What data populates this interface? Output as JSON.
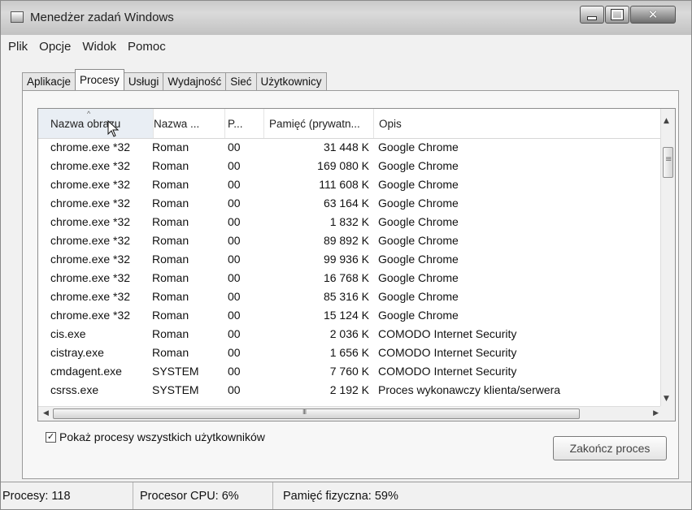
{
  "window": {
    "title": "Menedżer zadań Windows",
    "controls": [
      "minimize",
      "maximize",
      "close"
    ]
  },
  "menu": [
    "Plik",
    "Opcje",
    "Widok",
    "Pomoc"
  ],
  "tabs": {
    "items": [
      "Aplikacje",
      "Procesy",
      "Usługi",
      "Wydajność",
      "Sieć",
      "Użytkownicy"
    ],
    "active": "Procesy"
  },
  "table": {
    "columns": [
      "Nazwa obrazu",
      "Nazwa ...",
      "P...",
      "Pamięć (prywatn...",
      "Opis"
    ],
    "sorted_column": "Nazwa obrazu",
    "rows": [
      {
        "name": "chrome.exe *32",
        "user": "Roman",
        "cpu": "00",
        "memory": "31 448 K",
        "description": "Google Chrome"
      },
      {
        "name": "chrome.exe *32",
        "user": "Roman",
        "cpu": "00",
        "memory": "169 080 K",
        "description": "Google Chrome"
      },
      {
        "name": "chrome.exe *32",
        "user": "Roman",
        "cpu": "00",
        "memory": "111 608 K",
        "description": "Google Chrome"
      },
      {
        "name": "chrome.exe *32",
        "user": "Roman",
        "cpu": "00",
        "memory": "63 164 K",
        "description": "Google Chrome"
      },
      {
        "name": "chrome.exe *32",
        "user": "Roman",
        "cpu": "00",
        "memory": "1 832 K",
        "description": "Google Chrome"
      },
      {
        "name": "chrome.exe *32",
        "user": "Roman",
        "cpu": "00",
        "memory": "89 892 K",
        "description": "Google Chrome"
      },
      {
        "name": "chrome.exe *32",
        "user": "Roman",
        "cpu": "00",
        "memory": "99 936 K",
        "description": "Google Chrome"
      },
      {
        "name": "chrome.exe *32",
        "user": "Roman",
        "cpu": "00",
        "memory": "16 768 K",
        "description": "Google Chrome"
      },
      {
        "name": "chrome.exe *32",
        "user": "Roman",
        "cpu": "00",
        "memory": "85 316 K",
        "description": "Google Chrome"
      },
      {
        "name": "chrome.exe *32",
        "user": "Roman",
        "cpu": "00",
        "memory": "15 124 K",
        "description": "Google Chrome"
      },
      {
        "name": "cis.exe",
        "user": "Roman",
        "cpu": "00",
        "memory": "2 036 K",
        "description": "COMODO Internet Security"
      },
      {
        "name": "cistray.exe",
        "user": "Roman",
        "cpu": "00",
        "memory": "1 656 K",
        "description": "COMODO Internet Security"
      },
      {
        "name": "cmdagent.exe",
        "user": "SYSTEM",
        "cpu": "00",
        "memory": "7 760 K",
        "description": "COMODO Internet Security"
      },
      {
        "name": "csrss.exe",
        "user": "SYSTEM",
        "cpu": "00",
        "memory": "2 192 K",
        "description": "Proces wykonawczy klienta/serwera"
      }
    ]
  },
  "show_all_users": {
    "label": "Pokaż procesy wszystkich użytkowników",
    "checked": true
  },
  "end_process_button": "Zakończ proces",
  "status": {
    "processes": "Procesy: 118",
    "cpu": "Procesor CPU: 6%",
    "memory": "Pamięć fizyczna: 59%"
  },
  "icons": {
    "app": "task-manager-icon",
    "sort": "sort-up-icon",
    "cursor": "mouse-pointer-icon"
  }
}
